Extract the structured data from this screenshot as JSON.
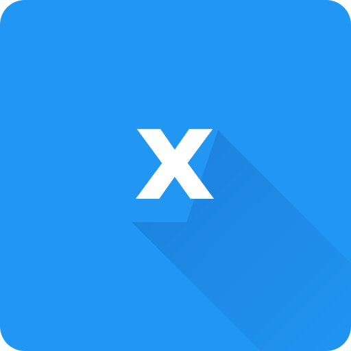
{
  "icon": {
    "letter": "x",
    "name": "x-letter-icon",
    "background_color": "#2196f3",
    "letter_color": "#ffffff",
    "long_shadow_color": "#1565c0"
  }
}
